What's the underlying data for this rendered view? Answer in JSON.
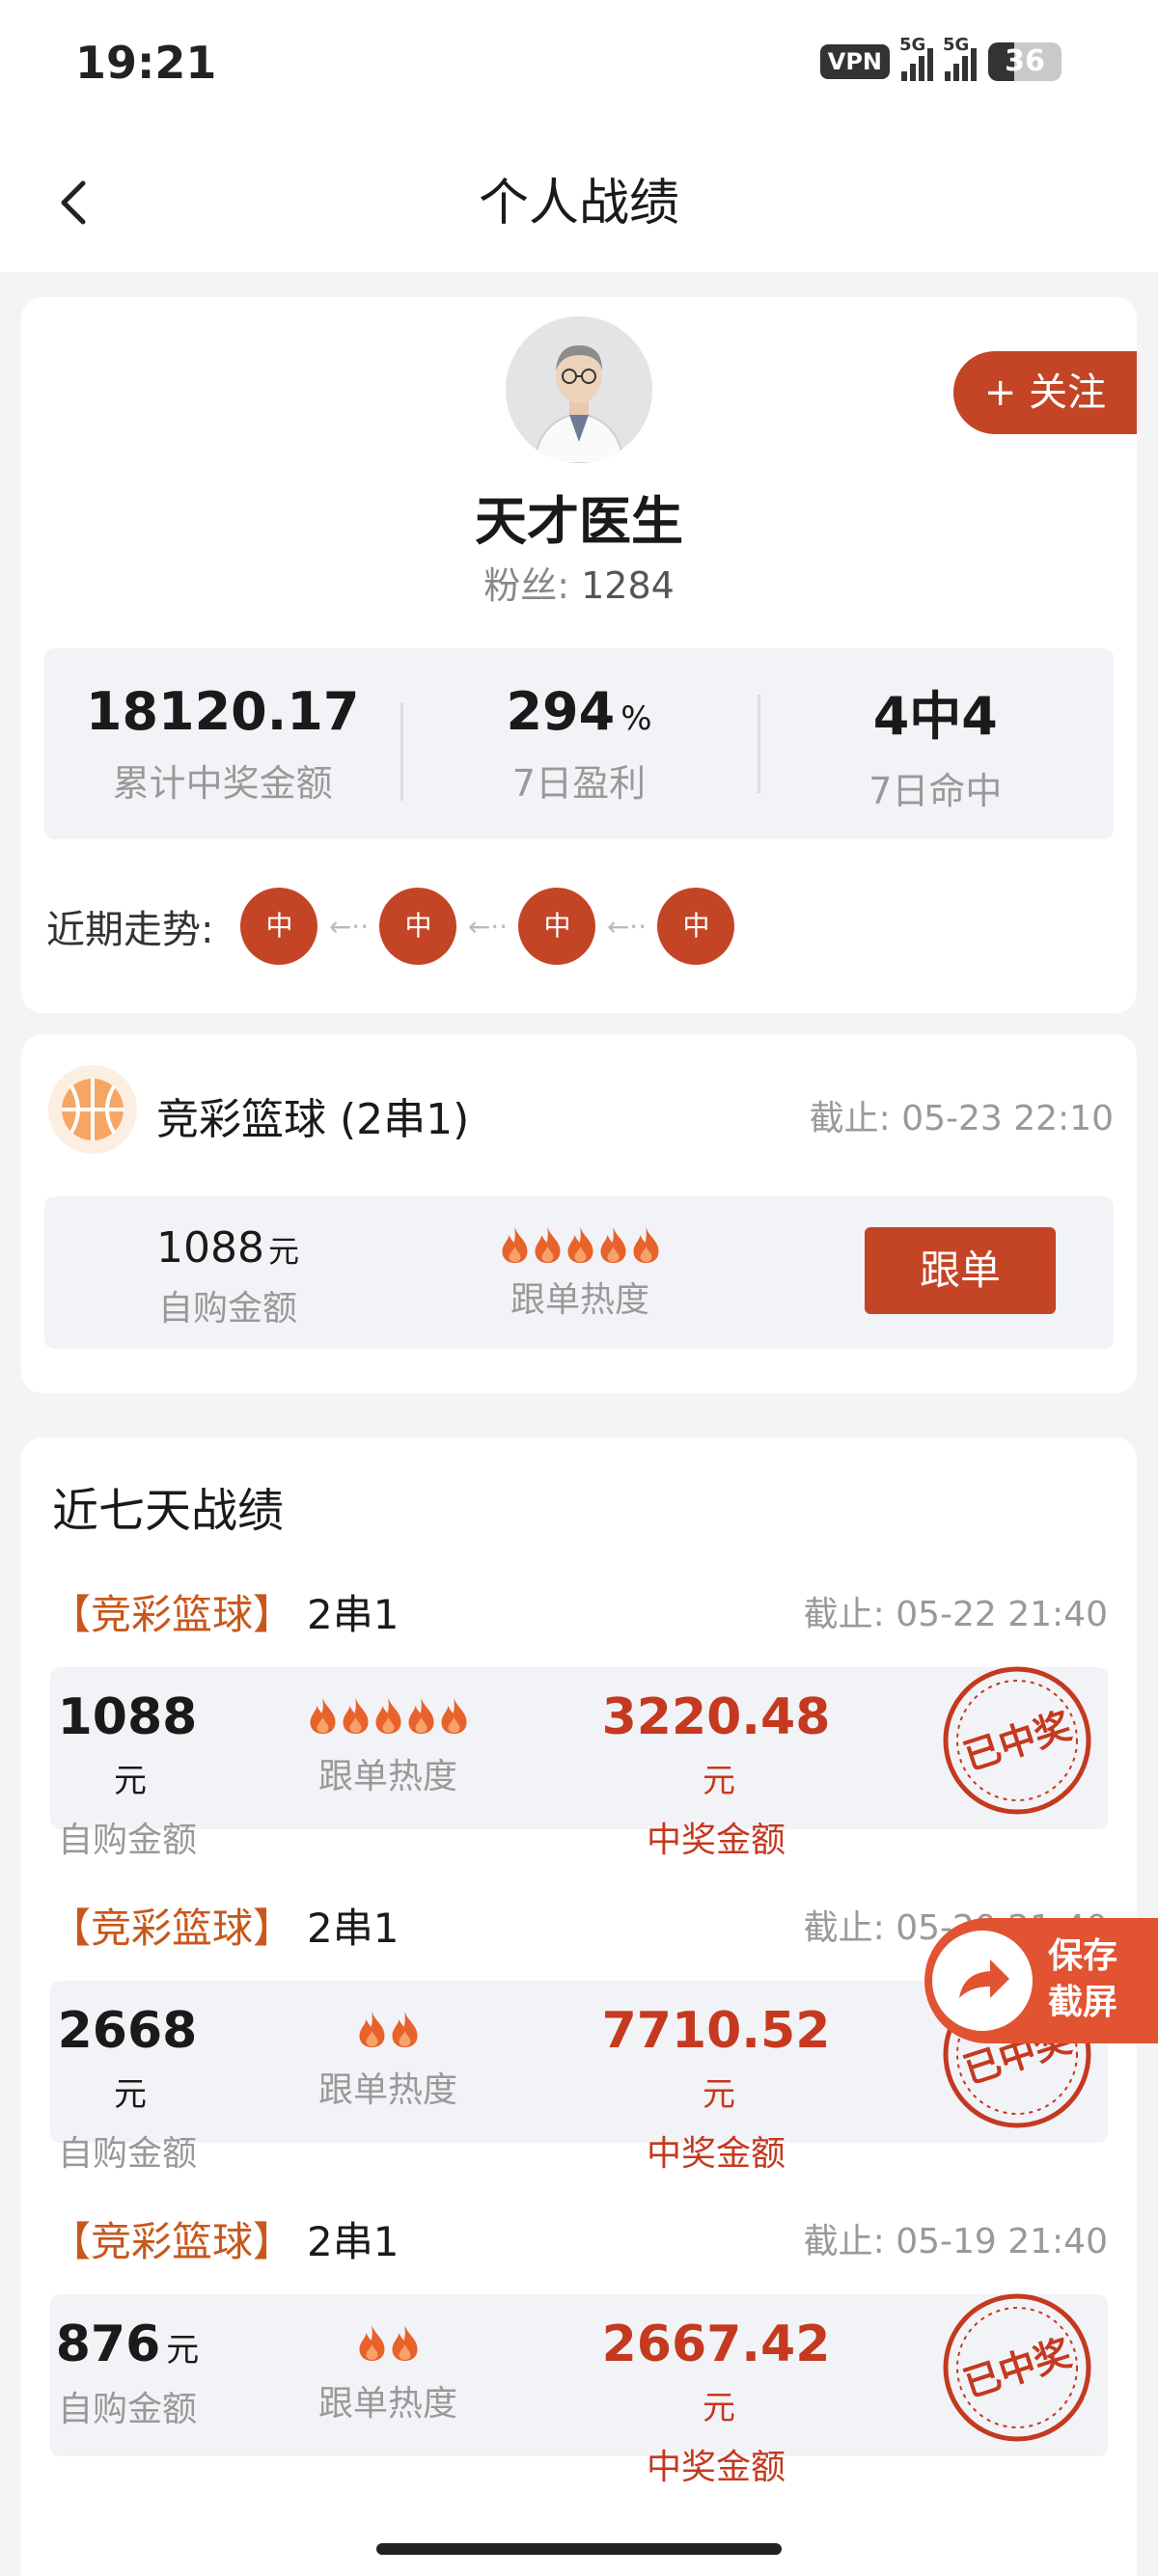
{
  "status_bar": {
    "time": "19:21",
    "vpn": "VPN",
    "network_1": "5G",
    "network_2": "5G",
    "battery": "36",
    "battery_level": 0.36
  },
  "header": {
    "title": "个人战绩"
  },
  "profile": {
    "follow_label": "+ 关注",
    "name": "天才医生",
    "fans_label": "粉丝:",
    "fans_count": "1284",
    "stats": [
      {
        "value": "18120.17",
        "unit": "",
        "label": "累计中奖金额"
      },
      {
        "value": "294",
        "unit": "%",
        "label": "7日盈利"
      },
      {
        "value": "4中4",
        "unit": "",
        "label": "7日命中"
      }
    ],
    "trend_label": "近期走势:",
    "trend": [
      "中",
      "中",
      "中",
      "中"
    ],
    "trend_arrow": "←··"
  },
  "plan": {
    "title": "竞彩篮球 (2串1)",
    "deadline": "截止: 05-23 22:10",
    "amount": "1088",
    "amount_unit": "元",
    "amount_label": "自购金额",
    "heat": 5,
    "heat_label": "跟单热度",
    "follow_button": "跟单"
  },
  "history": {
    "title": "近七天战绩",
    "records": [
      {
        "tag": "【竞彩篮球】",
        "type": "2串1",
        "deadline": "截止: 05-22 21:40",
        "amount": "1088",
        "unit": "元",
        "amount_label": "自购金额",
        "heat": 5,
        "heat_label": "跟单热度",
        "win": "3220.48",
        "win_unit": "元",
        "win_label": "中奖金额",
        "stamp": "已中奖"
      },
      {
        "tag": "【竞彩篮球】",
        "type": "2串1",
        "deadline": "截止: 05-20 21:40",
        "amount": "2668",
        "unit": "元",
        "amount_label": "自购金额",
        "heat": 2,
        "heat_label": "跟单热度",
        "win": "7710.52",
        "win_unit": "元",
        "win_label": "中奖金额",
        "stamp": "已中奖"
      },
      {
        "tag": "【竞彩篮球】",
        "type": "2串1",
        "deadline": "截止: 05-19 21:40",
        "amount": "876",
        "unit": "元",
        "amount_label": "自购金额",
        "heat": 2,
        "heat_label": "跟单热度",
        "win": "2667.42",
        "win_unit": "元",
        "win_label": "中奖金额",
        "stamp": "已中奖"
      }
    ]
  },
  "save_float": {
    "line1": "保存",
    "line2": "截屏"
  },
  "colors": {
    "accent": "#c44426",
    "win": "#c4391f",
    "tag": "#c8571a",
    "flame": "#e8622c"
  }
}
